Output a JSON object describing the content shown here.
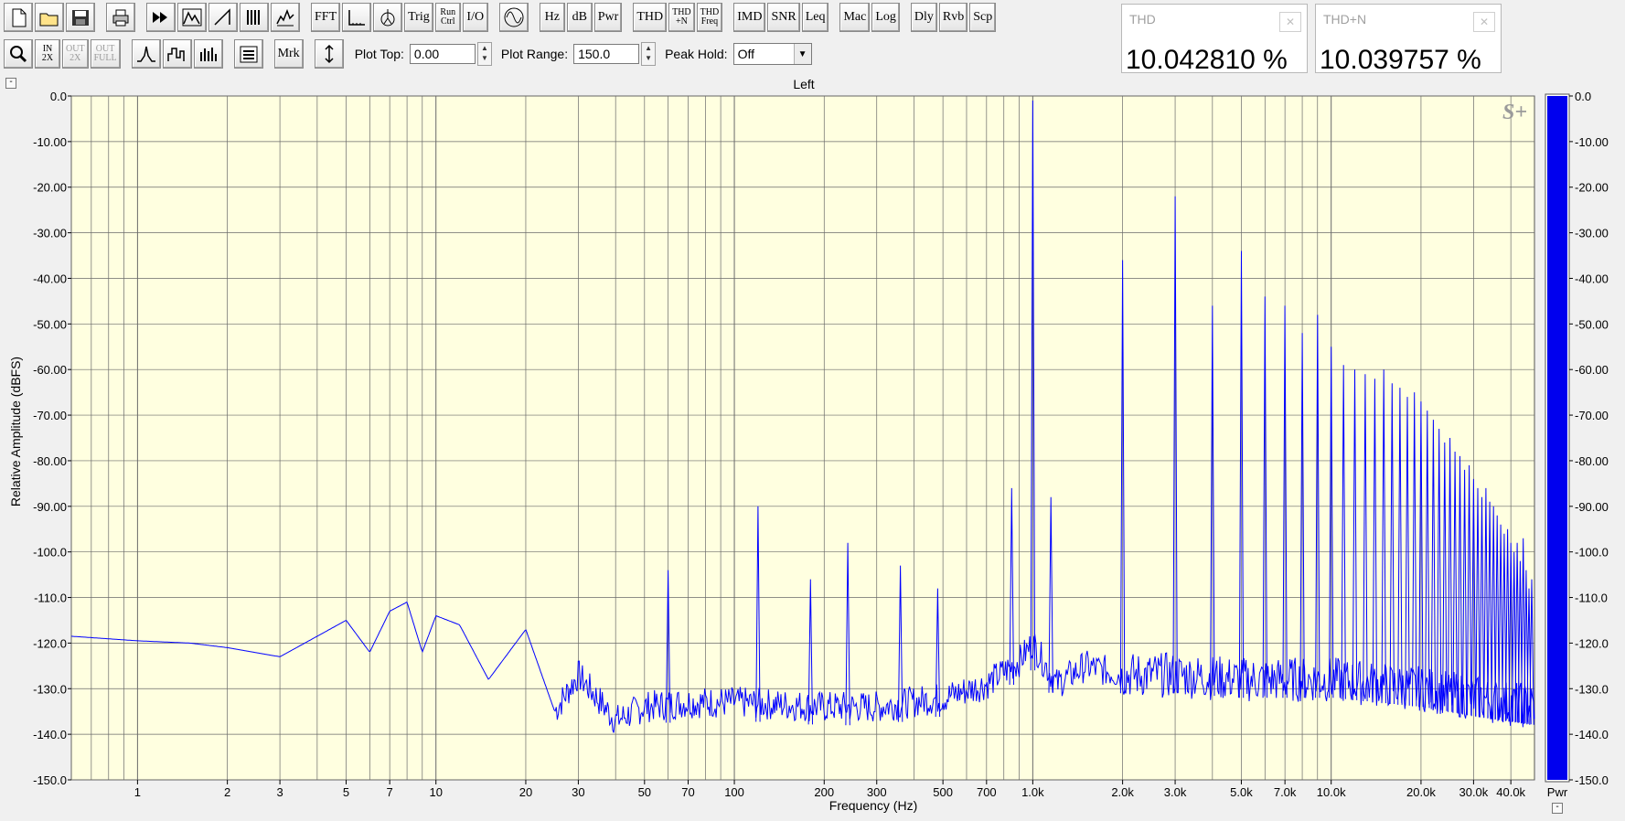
{
  "toolbar": {
    "row1": [
      {
        "name": "new-file-button",
        "icon": "new-file-icon"
      },
      {
        "name": "open-file-button",
        "icon": "folder-open-icon"
      },
      {
        "name": "save-file-button",
        "icon": "floppy-disk-icon"
      },
      {
        "name": "print-button",
        "icon": "printer-icon"
      },
      {
        "name": "fast-forward-button",
        "icon": "fast-forward-icon"
      },
      {
        "name": "averaging-button",
        "icon": "averaging-icon"
      },
      {
        "name": "sawtooth-button",
        "icon": "sawtooth-icon"
      },
      {
        "name": "spectrogram-button",
        "icon": "spectrogram-icon"
      },
      {
        "name": "waterfall-button",
        "icon": "waterfall-icon"
      },
      {
        "label": "FFT",
        "name": "fft-button"
      },
      {
        "name": "axis-button",
        "icon": "axis-icon"
      },
      {
        "name": "probe-button",
        "icon": "probe-icon"
      },
      {
        "label": "Trig",
        "name": "trig-button"
      },
      {
        "label": "Run\nCtrl",
        "name": "run-ctrl-button"
      },
      {
        "label": "I/O",
        "name": "io-button"
      },
      {
        "name": "generator-button",
        "icon": "sine-wave-icon"
      },
      {
        "label": "Hz",
        "name": "hz-button"
      },
      {
        "label": "dB",
        "name": "db-button"
      },
      {
        "label": "Pwr",
        "name": "pwr-button"
      },
      {
        "label": "THD",
        "name": "thd-button"
      },
      {
        "label": "THD\n+N",
        "name": "thd-n-button"
      },
      {
        "label": "THD\nFreq",
        "name": "thd-freq-button"
      },
      {
        "label": "IMD",
        "name": "imd-button"
      },
      {
        "label": "SNR",
        "name": "snr-button"
      },
      {
        "label": "Leq",
        "name": "leq-button"
      },
      {
        "label": "Mac",
        "name": "mac-button"
      },
      {
        "label": "Log",
        "name": "log-button"
      },
      {
        "label": "Dly",
        "name": "dly-button"
      },
      {
        "label": "Rvb",
        "name": "rvb-button"
      },
      {
        "label": "Scp",
        "name": "scp-button"
      }
    ],
    "row2": [
      {
        "name": "zoom-button",
        "icon": "magnifier-icon"
      },
      {
        "label": "IN\n2X",
        "name": "zoom-in-2x-button"
      },
      {
        "label": "OUT\n2X",
        "name": "zoom-out-2x-button",
        "disabled": true
      },
      {
        "label": "OUT\nFULL",
        "name": "zoom-out-full-button",
        "disabled": true
      },
      {
        "name": "peak-button",
        "icon": "peak-icon"
      },
      {
        "name": "step-button",
        "icon": "step-icon"
      },
      {
        "name": "bars-button",
        "icon": "bars-icon"
      },
      {
        "name": "list-button",
        "icon": "list-icon"
      },
      {
        "label": "Mrk",
        "name": "mrk-button"
      },
      {
        "name": "range-button",
        "icon": "range-icon"
      }
    ],
    "plot_top_label": "Plot Top:",
    "plot_top_value": "0.00",
    "plot_range_label": "Plot Range:",
    "plot_range_value": "150.0",
    "peak_hold_label": "Peak Hold:",
    "peak_hold_value": "Off"
  },
  "meters": [
    {
      "title": "THD",
      "value": "10.042810 %"
    },
    {
      "title": "THD+N",
      "value": "10.039757 %"
    }
  ],
  "chart_data": {
    "type": "line",
    "title": "Left",
    "xlabel": "Frequency (Hz)",
    "ylabel": "Relative Amplitude (dBFS)",
    "x_scale": "log",
    "xlim": [
      0.6,
      48000
    ],
    "ylim": [
      -150,
      0
    ],
    "grid": true,
    "background": "#ffffe0",
    "line_color": "#0000ff",
    "y_ticks": [
      0,
      -10,
      -20,
      -30,
      -40,
      -50,
      -60,
      -70,
      -80,
      -90,
      -100,
      -110,
      -120,
      -130,
      -140,
      -150
    ],
    "y_tick_labels": [
      "0.0",
      "-10.00",
      "-20.00",
      "-30.00",
      "-40.00",
      "-50.00",
      "-60.00",
      "-70.00",
      "-80.00",
      "-90.00",
      "-100.0",
      "-110.0",
      "-120.0",
      "-130.0",
      "-140.0",
      "-150.0"
    ],
    "x_tick_values": [
      1,
      2,
      3,
      5,
      7,
      10,
      20,
      30,
      50,
      70,
      100,
      200,
      300,
      500,
      700,
      1000,
      2000,
      3000,
      5000,
      7000,
      10000,
      20000,
      30000,
      40000
    ],
    "x_tick_labels": [
      "1",
      "2",
      "3",
      "5",
      "7",
      "10",
      "20",
      "30",
      "50",
      "70",
      "100",
      "200",
      "300",
      "500",
      "700",
      "1.0k",
      "2.0k",
      "3.0k",
      "5.0k",
      "7.0k",
      "10.0k",
      "20.0k",
      "30.0k",
      "40.0k"
    ],
    "watermark": "S+",
    "noise_floor": [
      [
        0.6,
        -118.5
      ],
      [
        1,
        -119.5
      ],
      [
        1.5,
        -120
      ],
      [
        2,
        -121
      ],
      [
        3,
        -123
      ],
      [
        4,
        -118.5
      ],
      [
        5,
        -115
      ],
      [
        6,
        -122
      ],
      [
        7,
        -113
      ],
      [
        8,
        -111
      ],
      [
        9,
        -122
      ],
      [
        10,
        -114
      ],
      [
        12,
        -116
      ],
      [
        15,
        -128
      ],
      [
        20,
        -117
      ],
      [
        25,
        -135
      ],
      [
        30,
        -127
      ],
      [
        40,
        -137
      ],
      [
        50,
        -134
      ],
      [
        70,
        -133
      ],
      [
        100,
        -133
      ],
      [
        200,
        -134
      ],
      [
        300,
        -134
      ],
      [
        500,
        -132
      ],
      [
        700,
        -129
      ],
      [
        900,
        -124
      ],
      [
        1000,
        -120
      ],
      [
        1200,
        -129
      ],
      [
        1500,
        -125
      ],
      [
        2000,
        -127
      ],
      [
        3000,
        -127
      ],
      [
        5000,
        -128
      ],
      [
        10000,
        -128
      ],
      [
        20000,
        -130
      ],
      [
        30000,
        -132
      ],
      [
        48000,
        -134
      ]
    ],
    "peaks": [
      {
        "freq": 60,
        "db": -104
      },
      {
        "freq": 120,
        "db": -90
      },
      {
        "freq": 180,
        "db": -106
      },
      {
        "freq": 240,
        "db": -98
      },
      {
        "freq": 360,
        "db": -103
      },
      {
        "freq": 480,
        "db": -108
      },
      {
        "freq": 850,
        "db": -86
      },
      {
        "freq": 1000,
        "db": -1
      },
      {
        "freq": 1150,
        "db": -88
      },
      {
        "freq": 2000,
        "db": -36
      },
      {
        "freq": 3000,
        "db": -22
      },
      {
        "freq": 4000,
        "db": -46
      },
      {
        "freq": 5000,
        "db": -34
      },
      {
        "freq": 6000,
        "db": -44
      },
      {
        "freq": 7000,
        "db": -46
      },
      {
        "freq": 8000,
        "db": -52
      },
      {
        "freq": 9000,
        "db": -48
      },
      {
        "freq": 10000,
        "db": -55
      },
      {
        "freq": 11000,
        "db": -59
      },
      {
        "freq": 12000,
        "db": -60
      },
      {
        "freq": 13000,
        "db": -61
      },
      {
        "freq": 14000,
        "db": -62
      },
      {
        "freq": 15000,
        "db": -60
      },
      {
        "freq": 16000,
        "db": -63
      },
      {
        "freq": 17000,
        "db": -64
      },
      {
        "freq": 18000,
        "db": -66
      },
      {
        "freq": 19000,
        "db": -65
      },
      {
        "freq": 20000,
        "db": -67
      },
      {
        "freq": 21000,
        "db": -69
      },
      {
        "freq": 22000,
        "db": -71
      },
      {
        "freq": 23000,
        "db": -73
      },
      {
        "freq": 24000,
        "db": -76
      },
      {
        "freq": 25000,
        "db": -75
      },
      {
        "freq": 26000,
        "db": -78
      },
      {
        "freq": 27000,
        "db": -79
      },
      {
        "freq": 28000,
        "db": -82
      },
      {
        "freq": 29000,
        "db": -81
      },
      {
        "freq": 30000,
        "db": -84
      },
      {
        "freq": 31000,
        "db": -86
      },
      {
        "freq": 32000,
        "db": -88
      },
      {
        "freq": 33000,
        "db": -86
      },
      {
        "freq": 34000,
        "db": -89
      },
      {
        "freq": 35000,
        "db": -90
      },
      {
        "freq": 36000,
        "db": -92
      },
      {
        "freq": 37000,
        "db": -94
      },
      {
        "freq": 38000,
        "db": -96
      },
      {
        "freq": 39000,
        "db": -95
      },
      {
        "freq": 40000,
        "db": -98
      },
      {
        "freq": 41000,
        "db": -100
      },
      {
        "freq": 42000,
        "db": -98
      },
      {
        "freq": 43000,
        "db": -102
      },
      {
        "freq": 44000,
        "db": -97
      },
      {
        "freq": 45000,
        "db": -104
      },
      {
        "freq": 46000,
        "db": -108
      },
      {
        "freq": 47000,
        "db": -106
      }
    ],
    "level_meter": {
      "label": "Pwr",
      "value_db": 0,
      "color": "#0000ee"
    }
  }
}
